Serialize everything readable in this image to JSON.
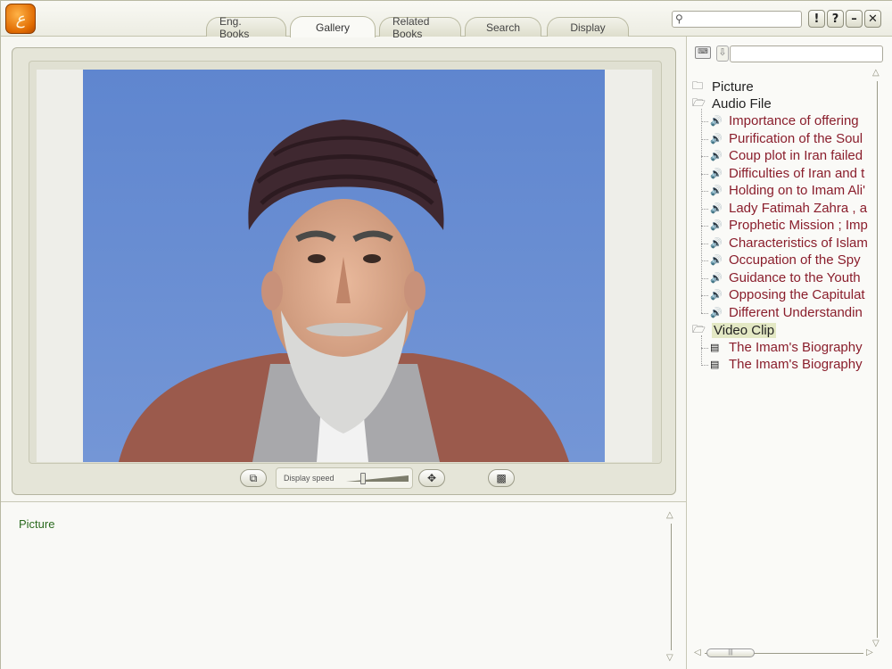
{
  "app": {
    "logo_glyph": "ﻉ"
  },
  "tabs": [
    {
      "label": "Eng. Books",
      "active": false
    },
    {
      "label": "Gallery",
      "active": true
    },
    {
      "label": "Related Books",
      "active": false
    },
    {
      "label": "Search",
      "active": false
    },
    {
      "label": "Display",
      "active": false
    }
  ],
  "search": {
    "value": "",
    "placeholder": ""
  },
  "window_buttons": {
    "alert": "!",
    "help": "?",
    "minimize": "–",
    "close": "✕"
  },
  "viewer": {
    "speed_label": "Display speed",
    "speed_value": 0.25
  },
  "caption": {
    "text": "Picture"
  },
  "sidebar": {
    "filter": {
      "value": "",
      "placeholder": ""
    },
    "folders": [
      {
        "label": "Picture",
        "open": false,
        "items": []
      },
      {
        "label": "Audio File",
        "open": true,
        "item_icon": "speaker-icon",
        "items": [
          "Importance of offering",
          "Purification of the Soul",
          "Coup plot in Iran failed",
          "Difficulties of Iran and t",
          "Holding on to Imam Ali'",
          "Lady Fatimah Zahra , a",
          "Prophetic Mission ; Imp",
          "Characteristics of Islam",
          "Occupation of the Spy",
          "Guidance to the Youth",
          "Opposing the Capitulat",
          "Different Understandin"
        ]
      },
      {
        "label": "Video Clip",
        "open": true,
        "selected": true,
        "item_icon": "film-icon",
        "items": [
          "The Imam's Biography",
          "The Imam's Biography"
        ]
      }
    ]
  },
  "colors": {
    "item_text": "#8a1e2c",
    "caption_text": "#2a6a1e",
    "selection": "#e3e8c4"
  }
}
